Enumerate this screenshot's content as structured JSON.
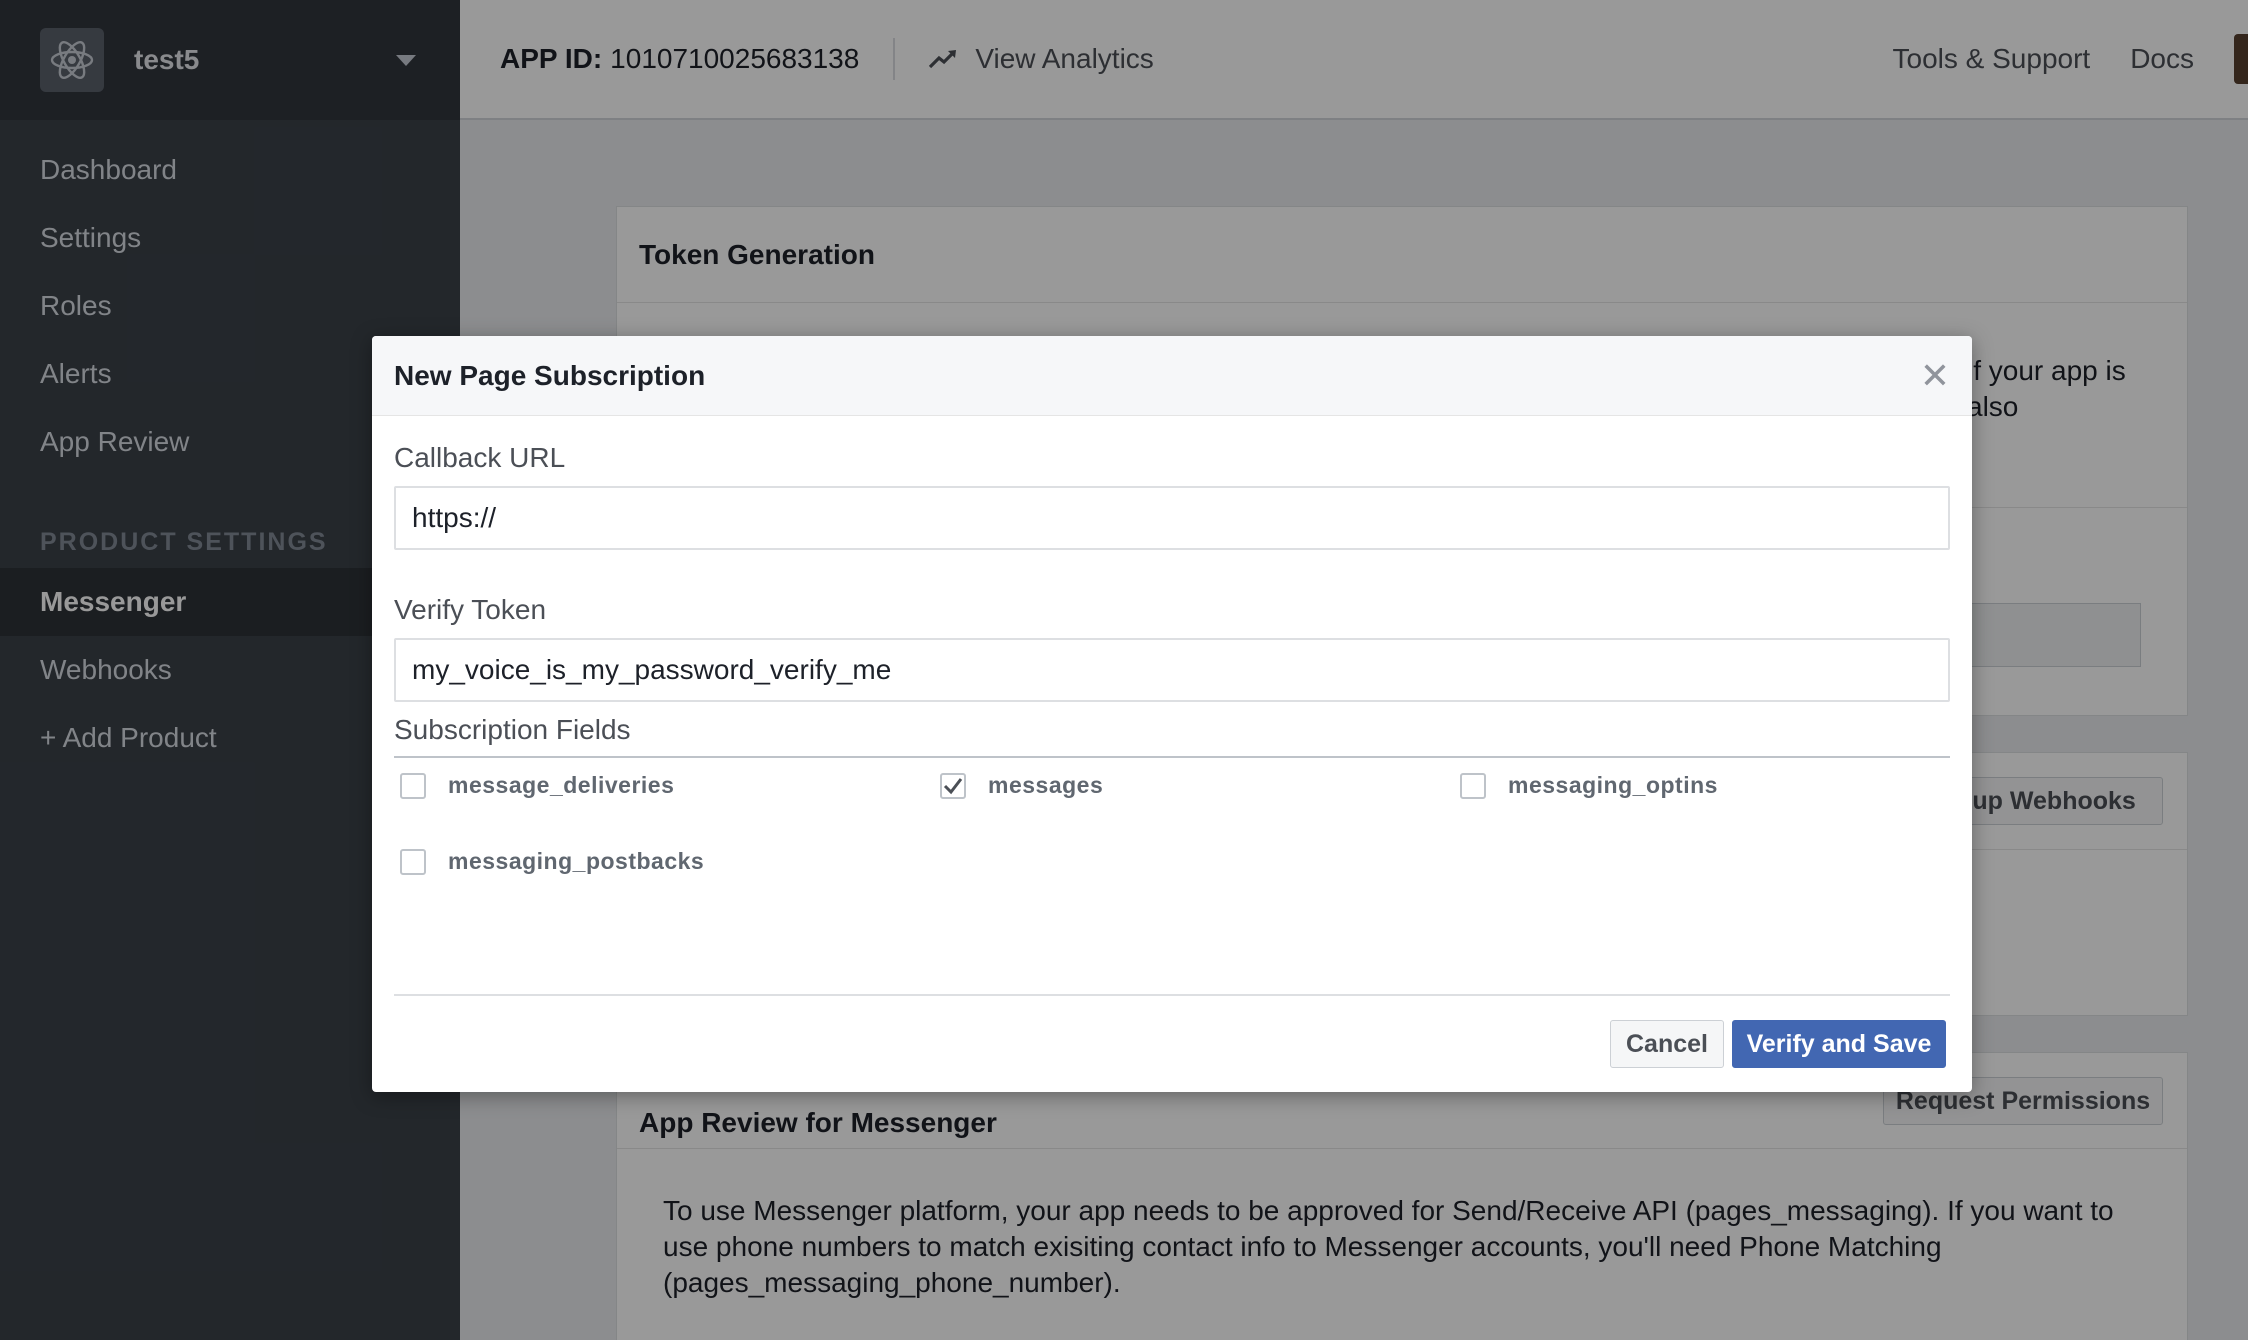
{
  "sidebar": {
    "app_name": "test5",
    "items": [
      {
        "label": "Dashboard"
      },
      {
        "label": "Settings"
      },
      {
        "label": "Roles"
      },
      {
        "label": "Alerts"
      },
      {
        "label": "App Review"
      }
    ],
    "section_label": "PRODUCT SETTINGS",
    "product_items": [
      {
        "label": "Messenger"
      },
      {
        "label": "Webhooks"
      },
      {
        "label": "+ Add Product"
      }
    ]
  },
  "topbar": {
    "app_id_label": "APP ID:",
    "app_id": "1010710025683138",
    "analytics": "View Analytics",
    "tools": "Tools & Support",
    "docs": "Docs"
  },
  "background": {
    "token_title": "Token Generation",
    "token_text_1": "if your app is",
    "token_text_2": "also",
    "webhooks_button": "etup Webhooks",
    "review_title": "App Review for Messenger",
    "request_button": "Request Permissions",
    "review_text": "To use Messenger platform, your app needs to be approved for Send/Receive API (pages_messaging). If you want to use phone numbers to match exisiting contact info to Messenger accounts, you'll need Phone Matching (pages_messaging_phone_number)."
  },
  "modal": {
    "title": "New Page Subscription",
    "callback_label": "Callback URL",
    "callback_value": "https://",
    "verify_label": "Verify Token",
    "verify_value": "my_voice_is_my_password_verify_me",
    "fields_label": "Subscription Fields",
    "fields": [
      {
        "label": "message_deliveries",
        "checked": false
      },
      {
        "label": "messages",
        "checked": true
      },
      {
        "label": "messaging_optins",
        "checked": false
      },
      {
        "label": "messaging_postbacks",
        "checked": false
      }
    ],
    "cancel": "Cancel",
    "save": "Verify and Save"
  },
  "colors": {
    "sidebar_bg": "#3b4149",
    "primary": "#4267b2"
  }
}
